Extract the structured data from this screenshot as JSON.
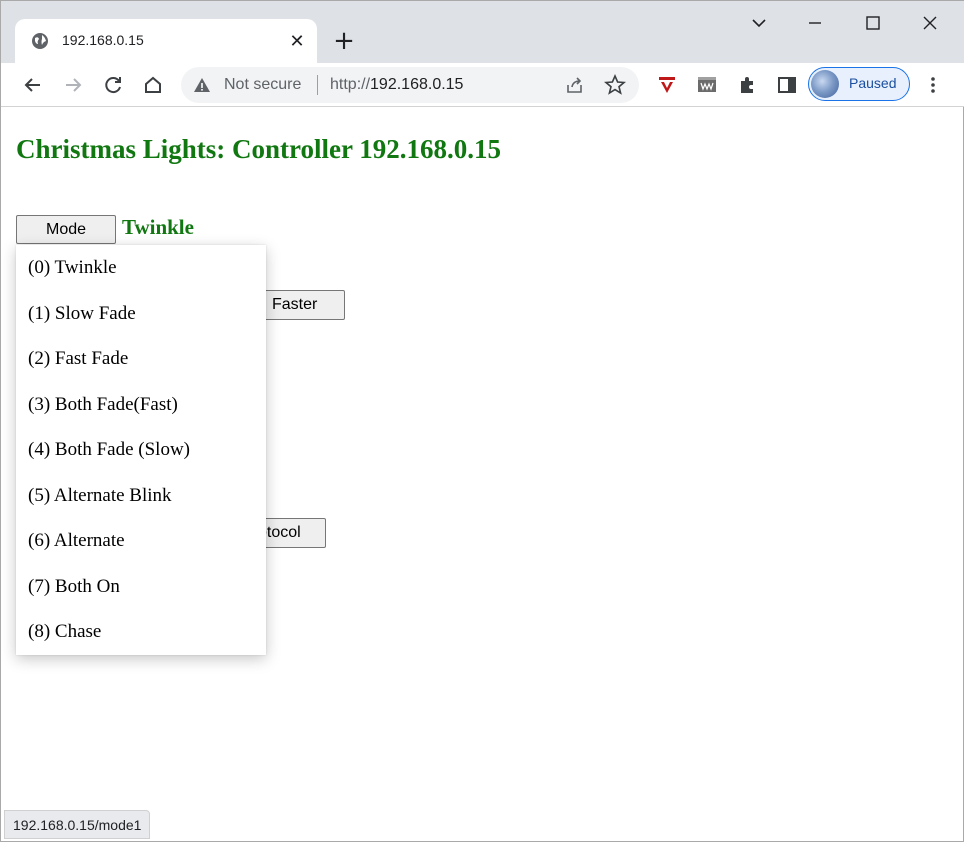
{
  "browser": {
    "tab_title": "192.168.0.15",
    "tab_close": "✕",
    "new_tab": "+",
    "omnibox": {
      "security_label": "Not secure",
      "url_scheme": "http://",
      "url_host": "192.168.0.15"
    },
    "profile_label": "Paused",
    "status_url": "192.168.0.15/mode1"
  },
  "page": {
    "title": "Christmas Lights: Controller 192.168.0.15",
    "mode_button": "Mode",
    "mode_value": "Twinkle",
    "faster_button": "Faster",
    "protocol_button": "otocol"
  },
  "dropdown": {
    "items": [
      "(0) Twinkle",
      "(1) Slow Fade",
      "(2) Fast Fade",
      "(3) Both Fade(Fast)",
      "(4) Both Fade (Slow)",
      "(5) Alternate Blink",
      "(6) Alternate",
      "(7) Both On",
      "(8) Chase"
    ]
  },
  "colors": {
    "heading_green": "#117711",
    "tabstrip_bg": "#dee1e6",
    "omnibox_bg": "#f1f3f4"
  },
  "icons": [
    "globe-icon",
    "close-icon",
    "plus-icon",
    "chevron-down-icon",
    "minimize-icon",
    "maximize-icon",
    "window-close-icon",
    "back-icon",
    "forward-icon",
    "reload-icon",
    "home-icon",
    "warning-icon",
    "share-icon",
    "star-icon",
    "mcafee-icon",
    "extension-icon",
    "puzzle-icon",
    "side-panel-icon",
    "menu-icon"
  ]
}
